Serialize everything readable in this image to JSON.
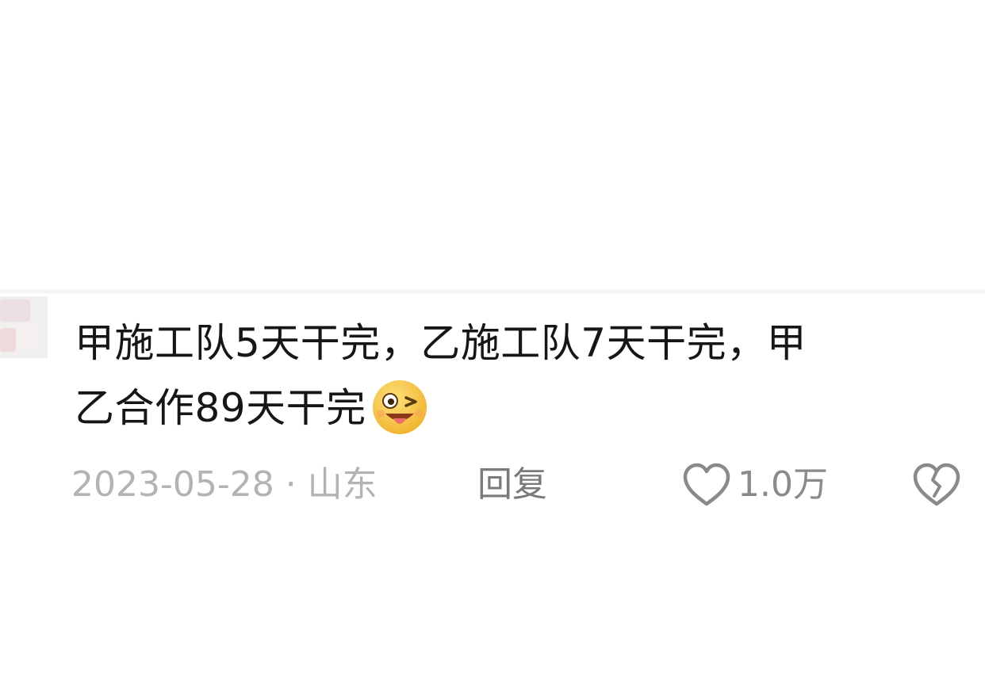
{
  "comment": {
    "line1": "甲施工队5天干完，乙施工队7天干完，甲",
    "line2": "乙合作89天干完",
    "emoji": "wink-tongue-emoji"
  },
  "meta": {
    "date_location": "2023-05-28 · 山东",
    "reply_label": "回复",
    "like_count": "1.0万",
    "like_icon": "heart-outline-icon",
    "dislike_icon": "broken-heart-icon"
  },
  "colors": {
    "text": "#161616",
    "meta_text": "#b3b3b3",
    "emoji_face": "#f7c64a"
  }
}
